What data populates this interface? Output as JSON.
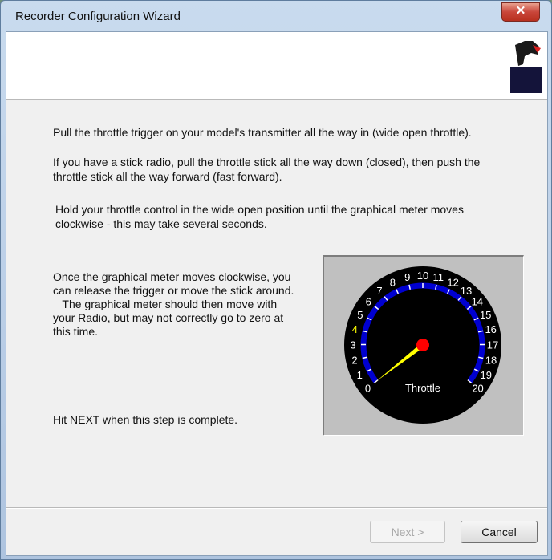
{
  "window": {
    "title": "Recorder Configuration Wizard",
    "close_glyph": "✕"
  },
  "content": {
    "p1": "Pull the throttle trigger on your model's transmitter all the way in (wide open throttle).",
    "p2_line1": "If you have a stick radio, pull the throttle stick all the way down (closed), then push the",
    "p2_line2": "throttle stick all the way forward (fast forward).",
    "p3_line1": "Hold your throttle control in the wide open position until the graphical meter moves",
    "p3_line2": "clockwise - this may take several seconds.",
    "p4_lines": [
      "Once the graphical meter moves clockwise, you",
      "can release the trigger or move the stick around.",
      "   The graphical meter should then move with",
      "your Radio, but may not correctly go to zero at",
      "this time."
    ],
    "p5": "Hit NEXT when this step is complete."
  },
  "gauge": {
    "label": "Throttle",
    "ticks": [
      "0",
      "1",
      "2",
      "3",
      "4",
      "5",
      "6",
      "7",
      "8",
      "9",
      "10",
      "11",
      "12",
      "13",
      "14",
      "15",
      "16",
      "17",
      "18",
      "19",
      "20"
    ],
    "min": 0,
    "max": 20,
    "value": 0,
    "highlight_tick": 4,
    "colors": {
      "face": "#000000",
      "ring": "#0000d0",
      "needle": "#ffff00",
      "hub": "#ff0000",
      "text": "#ffffff",
      "highlight": "#ffff00"
    }
  },
  "buttons": {
    "next": "Next >",
    "cancel": "Cancel"
  },
  "logo": {
    "icon": "eagle-logo-icon",
    "colors": {
      "bird": "#1a1a1a",
      "block": "#14143a",
      "beak": "#d81e1e"
    }
  }
}
